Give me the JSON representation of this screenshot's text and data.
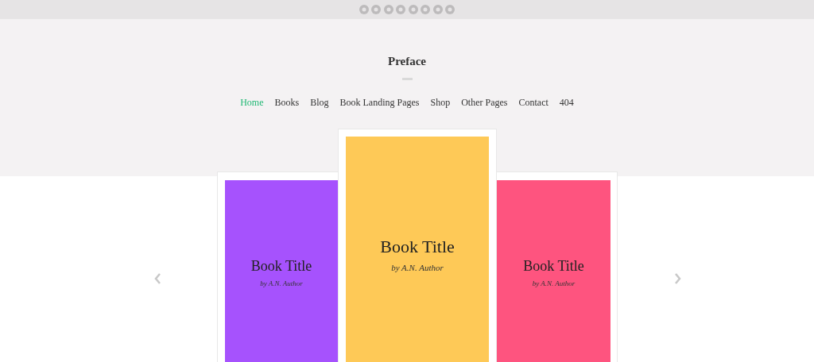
{
  "site_title": "Preface",
  "nav": [
    {
      "label": "Home",
      "selected": true
    },
    {
      "label": "Books",
      "selected": false
    },
    {
      "label": "Blog",
      "selected": false
    },
    {
      "label": "Book Landing Pages",
      "selected": false
    },
    {
      "label": "Shop",
      "selected": false
    },
    {
      "label": "Other Pages",
      "selected": false
    },
    {
      "label": "Contact",
      "selected": false
    },
    {
      "label": "404",
      "selected": false
    }
  ],
  "books": [
    {
      "title": "Book Title",
      "author": "by A.N. Author",
      "color": "#a652fd",
      "featured": false
    },
    {
      "title": "Book Title",
      "author": "by A.N. Author",
      "color": "#fec957",
      "featured": true
    },
    {
      "title": "Book Title",
      "author": "by A.N. Author",
      "color": "#fe547f",
      "featured": false
    }
  ]
}
